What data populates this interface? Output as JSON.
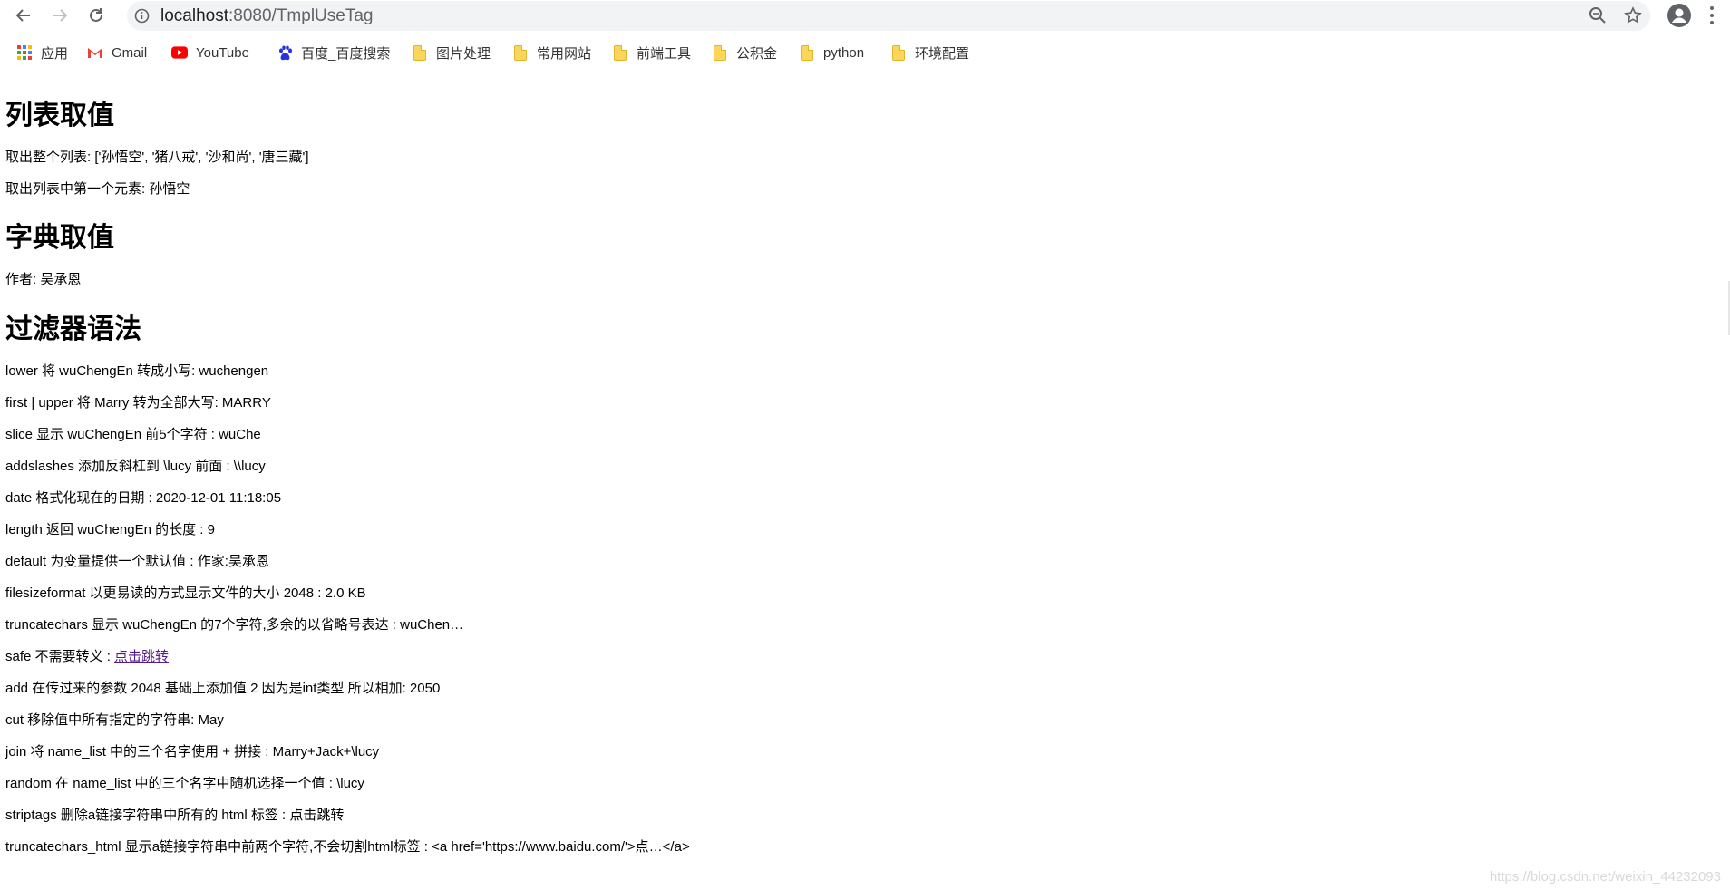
{
  "browser": {
    "url_host": "localhost",
    "url_path": ":8080/TmplUseTag",
    "bookmarks": [
      {
        "label": "应用",
        "icon": "apps-grid-icon"
      },
      {
        "label": "Gmail",
        "icon": "gmail-icon"
      },
      {
        "label": "YouTube",
        "icon": "youtube-icon"
      },
      {
        "label": "百度_百度搜索",
        "icon": "baidu-paw-icon"
      },
      {
        "label": "图片处理",
        "icon": "folder-icon"
      },
      {
        "label": "常用网站",
        "icon": "folder-icon"
      },
      {
        "label": "前端工具",
        "icon": "folder-icon"
      },
      {
        "label": "公积金",
        "icon": "folder-icon"
      },
      {
        "label": "python",
        "icon": "folder-icon"
      },
      {
        "label": "环境配置",
        "icon": "folder-icon"
      }
    ]
  },
  "sections": [
    {
      "title": "列表取值",
      "lines": [
        "取出整个列表: ['孙悟空', '猪八戒', '沙和尚', '唐三藏']",
        "取出列表中第一个元素: 孙悟空"
      ]
    },
    {
      "title": "字典取值",
      "lines": [
        "作者: 吴承恩"
      ]
    },
    {
      "title": "过滤器语法",
      "lines": [
        "lower 将 wuChengEn 转成小写: wuchengen",
        "first | upper 将 Marry 转为全部大写: MARRY",
        "slice 显示 wuChengEn 前5个字符 : wuChe",
        "addslashes 添加反斜杠到 \\lucy 前面 : \\\\lucy",
        "date 格式化现在的日期 : 2020-12-01 11:18:05",
        "length 返回 wuChengEn 的长度 : 9",
        "default 为变量提供一个默认值 : 作家:吴承恩",
        "filesizeformat 以更易读的方式显示文件的大小 2048 : 2.0 KB",
        "truncatechars 显示 wuChengEn 的7个字符,多余的以省略号表达 : wuChen…"
      ],
      "safe_prefix": "safe 不需要转义 : ",
      "safe_link": "点击跳转",
      "lines_after": [
        "add 在传过来的参数 2048 基础上添加值 2 因为是int类型 所以相加: 2050",
        "cut 移除值中所有指定的字符串: May",
        "join 将 name_list 中的三个名字使用 + 拼接 : Marry+Jack+\\lucy",
        "random 在 name_list 中的三个名字中随机选择一个值 : \\lucy",
        "striptags 删除a链接字符串中所有的 html 标签 : 点击跳转",
        "truncatechars_html 显示a链接字符串中前两个字符,不会切割html标签 : <a href='https://www.baidu.com/'>点…</a>"
      ]
    }
  ],
  "watermark": "https://blog.csdn.net/weixin_44232093"
}
